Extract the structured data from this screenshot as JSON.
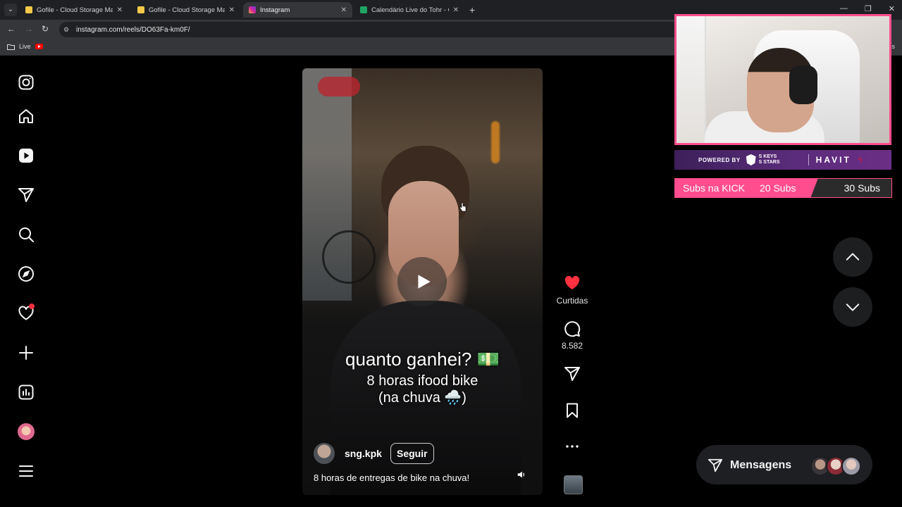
{
  "browser": {
    "tabs": [
      {
        "title": "Gofile - Cloud Storage Made Si",
        "active": false,
        "favicon_color": "#f7c948"
      },
      {
        "title": "Gofile - Cloud Storage Made Si",
        "active": false,
        "favicon_color": "#f7c948"
      },
      {
        "title": "Instagram",
        "active": true,
        "favicon_color": "#d6249f"
      },
      {
        "title": "Calendário Live do Tohr - Goog",
        "active": false,
        "favicon_color": "#1fa463"
      }
    ],
    "url": "instagram.com/reels/DO63Fa-km0F/",
    "bookmarks": [
      {
        "label": "Live"
      }
    ],
    "bookmarks_overflow": "os"
  },
  "sidebar": {
    "items": [
      {
        "icon": "instagram-logo-icon"
      },
      {
        "icon": "home-icon"
      },
      {
        "icon": "reels-icon"
      },
      {
        "icon": "direct-send-icon"
      },
      {
        "icon": "search-icon"
      },
      {
        "icon": "explore-compass-icon"
      },
      {
        "icon": "notifications-heart-icon",
        "has_dot": true
      },
      {
        "icon": "create-plus-icon"
      },
      {
        "icon": "dashboard-chart-icon"
      },
      {
        "icon": "profile-avatar"
      },
      {
        "icon": "more-menu-icon"
      }
    ]
  },
  "reel": {
    "caption_title": "quanto ganhei? 💵",
    "caption_line2": "8 horas ifood bike",
    "caption_line3": "(na chuva 🌧️)",
    "author": "sng.kpk",
    "follow_label": "Seguir",
    "description": "8 horas de entregas de bike na chuva!"
  },
  "actions": {
    "like_label": "Curtidas",
    "comments_count": "8.582"
  },
  "messages": {
    "label": "Mensagens"
  },
  "stream_overlay": {
    "sponsor_powered_by": "POWERED BY",
    "sponsor_brand_1": "S KEYS S STARS",
    "sponsor_brand_2": "HAVIT",
    "subs_label": "Subs na KICK",
    "subs_current": "20 Subs",
    "subs_goal": "30 Subs",
    "subs_progress": 0.66
  },
  "colors": {
    "accent_pink": "#ff4d8d",
    "like_red": "#ff3040"
  }
}
